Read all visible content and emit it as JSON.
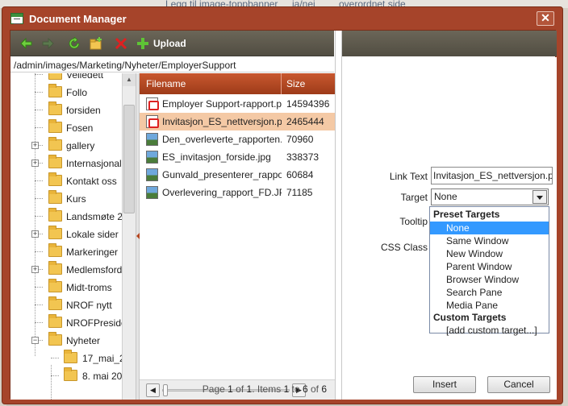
{
  "window": {
    "title": "Document Manager"
  },
  "background": {
    "text1": "Legg til image-toppbanner",
    "text2": "ja/nei",
    "text3": "overordnet side"
  },
  "toolbar": {
    "icons": [
      "arrow-left-icon",
      "arrow-right-icon",
      "refresh-icon",
      "new-folder-icon",
      "delete-icon",
      "plus-icon"
    ],
    "upload_label": "Upload"
  },
  "path": "/admin/images/Marketing/Nyheter/EmployerSupport",
  "tree": {
    "items": [
      {
        "label": "Veiledett",
        "expander": ""
      },
      {
        "label": "Follo",
        "expander": ""
      },
      {
        "label": "forsiden",
        "expander": ""
      },
      {
        "label": "Fosen",
        "expander": ""
      },
      {
        "label": "gallery",
        "expander": "+"
      },
      {
        "label": "Internasjonal",
        "expander": "+"
      },
      {
        "label": "Kontakt oss",
        "expander": ""
      },
      {
        "label": "Kurs",
        "expander": ""
      },
      {
        "label": "Landsmøte 2",
        "expander": ""
      },
      {
        "label": "Lokale sider",
        "expander": "+"
      },
      {
        "label": "Markeringer",
        "expander": ""
      },
      {
        "label": "Medlemsford",
        "expander": "+"
      },
      {
        "label": "Midt-troms",
        "expander": ""
      },
      {
        "label": "NROF nytt",
        "expander": ""
      },
      {
        "label": "NROFPreside",
        "expander": ""
      },
      {
        "label": "Nyheter",
        "expander": "−"
      }
    ],
    "children": [
      {
        "label": "17_mai_2"
      },
      {
        "label": "8. mai 20"
      }
    ]
  },
  "grid": {
    "columns": {
      "name": "Filename",
      "size": "Size"
    },
    "rows": [
      {
        "name": "Employer Support-rapport.pdf",
        "size": "14594396",
        "type": "pdf",
        "selected": false
      },
      {
        "name": "Invitasjon_ES_nettversjon.pdf",
        "size": "2465444",
        "type": "pdf",
        "selected": true
      },
      {
        "name": "Den_overleverte_rapporten.jpg",
        "size": "70960",
        "type": "img",
        "selected": false
      },
      {
        "name": "ES_invitasjon_forside.jpg",
        "size": "338373",
        "type": "img",
        "selected": false
      },
      {
        "name": "Gunvald_presenterer_rapport.jpg",
        "size": "60684",
        "type": "img",
        "selected": false
      },
      {
        "name": "Overlevering_rapport_FD.JPG",
        "size": "71185",
        "type": "img",
        "selected": false
      }
    ],
    "pager": {
      "prefix": "Page ",
      "page": "1",
      "of_text": " of ",
      "pages": "1",
      "items_text": ". Items ",
      "from": "1",
      "to_text": " to ",
      "to": "6",
      "of2_text": " of ",
      "total": "6"
    }
  },
  "form": {
    "link_text_label": "Link Text",
    "link_text_value": "Invitasjon_ES_nettversjon.pdf",
    "target_label": "Target",
    "target_value": "None",
    "tooltip_label": "Tooltip",
    "css_class_label": "CSS Class",
    "dropdown": {
      "preset_header": "Preset Targets",
      "preset_items": [
        "None",
        "Same Window",
        "New Window",
        "Parent Window",
        "Browser Window",
        "Search Pane",
        "Media Pane"
      ],
      "custom_header": "Custom Targets",
      "custom_items": [
        "[add custom target...]"
      ]
    },
    "insert_label": "Insert",
    "cancel_label": "Cancel"
  }
}
